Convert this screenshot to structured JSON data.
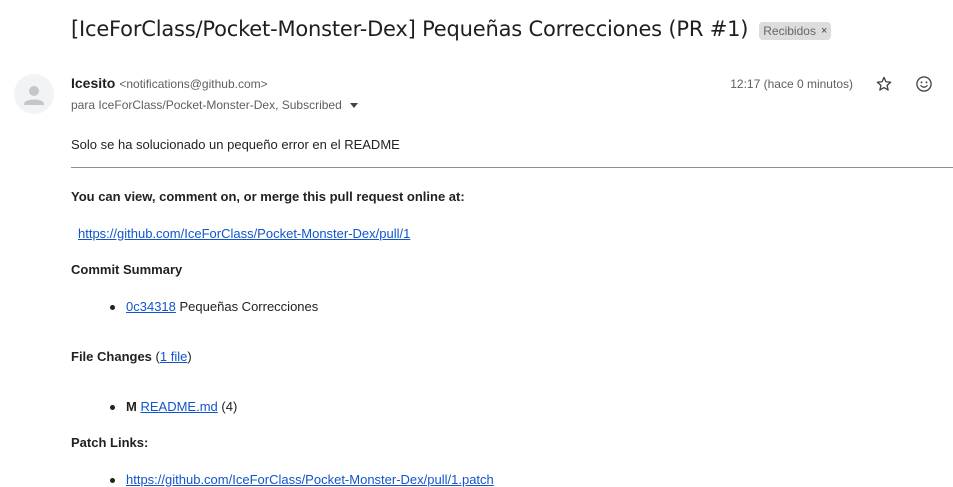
{
  "email": {
    "subject": "[IceForClass/Pocket-Monster-Dex] Pequeñas Correcciones (PR #1)",
    "label_chip": "Recibidos",
    "label_remove": "×",
    "sender_name": "Icesito",
    "sender_email": "<notifications@github.com>",
    "recipients": "para IceForClass/Pocket-Monster-Dex, Subscribed",
    "timestamp": "12:17 (hace 0 minutos)"
  },
  "body": {
    "intro": "Solo se ha solucionado un pequeño error en el README",
    "view_heading": "You can view, comment on, or merge this pull request online at:",
    "pr_url": "https://github.com/IceForClass/Pocket-Monster-Dex/pull/1",
    "commit_summary_heading": "Commit Summary",
    "commit": {
      "sha": "0c34318",
      "message": "Pequeñas Correcciones"
    },
    "file_changes": {
      "label": "File Changes",
      "open": "(",
      "link": "1 file",
      "close": ")"
    },
    "file": {
      "status": "M",
      "name": "README.md",
      "count": "(4)"
    },
    "patch_links_heading": "Patch Links:",
    "patch_url": "https://github.com/IceForClass/Pocket-Monster-Dex/pull/1.patch"
  },
  "icons": {
    "avatar": "person-avatar-icon",
    "star": "star-icon",
    "emoji": "emoji-reaction-icon",
    "recipients_dropdown": "chevron-down-icon"
  },
  "colors": {
    "link": "#1155cc",
    "chip_bg": "#dddddd",
    "secondary_text": "#5e5e5e"
  }
}
